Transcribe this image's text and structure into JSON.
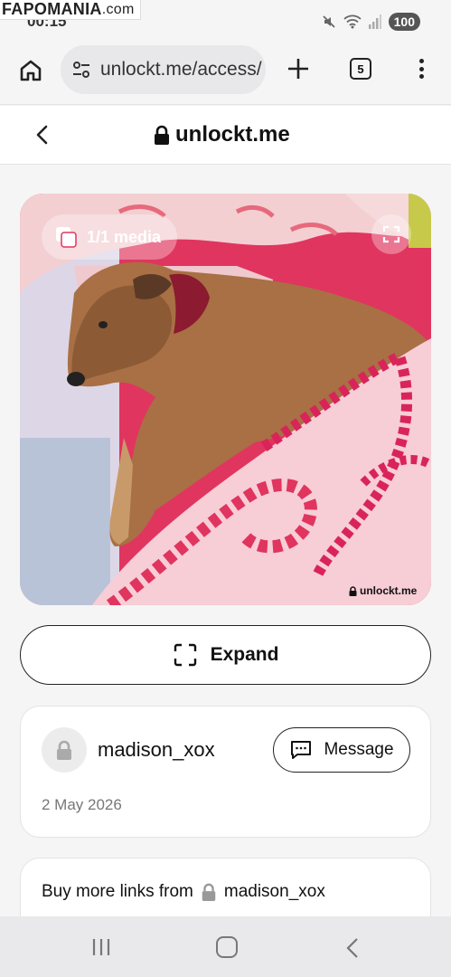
{
  "status_bar": {
    "time": "00:15",
    "battery": "100",
    "watermark_main": "FAPOMANIA",
    "watermark_tld": ".com"
  },
  "browser": {
    "url": "unlockt.me/access/",
    "tab_count": "5"
  },
  "site": {
    "brand": "unlockt.me"
  },
  "media": {
    "badge_label": "1/1 media",
    "watermark": "unlockt.me"
  },
  "actions": {
    "expand_label": "Expand"
  },
  "creator": {
    "username": "madison_xox",
    "message_label": "Message",
    "date": "2 May 2026"
  },
  "buy": {
    "prefix": "Buy more links from",
    "username": "madison_xox"
  },
  "icons": {
    "home": "home-icon",
    "tune": "tune-icon",
    "plus": "plus-icon",
    "tabs": "tabs-icon",
    "more": "more-vert-icon",
    "back": "chevron-left-icon",
    "lock": "lock-icon",
    "media_stack": "media-stack-icon",
    "fullscreen": "fullscreen-icon",
    "message": "chat-bubble-icon",
    "nav_recents": "recents-icon",
    "nav_home": "nav-home-icon",
    "nav_back": "nav-back-icon"
  },
  "colors": {
    "background": "#f5f5f5",
    "card": "#ffffff",
    "text": "#111111",
    "muted": "#777777",
    "url_bar": "#e8e8ea"
  }
}
